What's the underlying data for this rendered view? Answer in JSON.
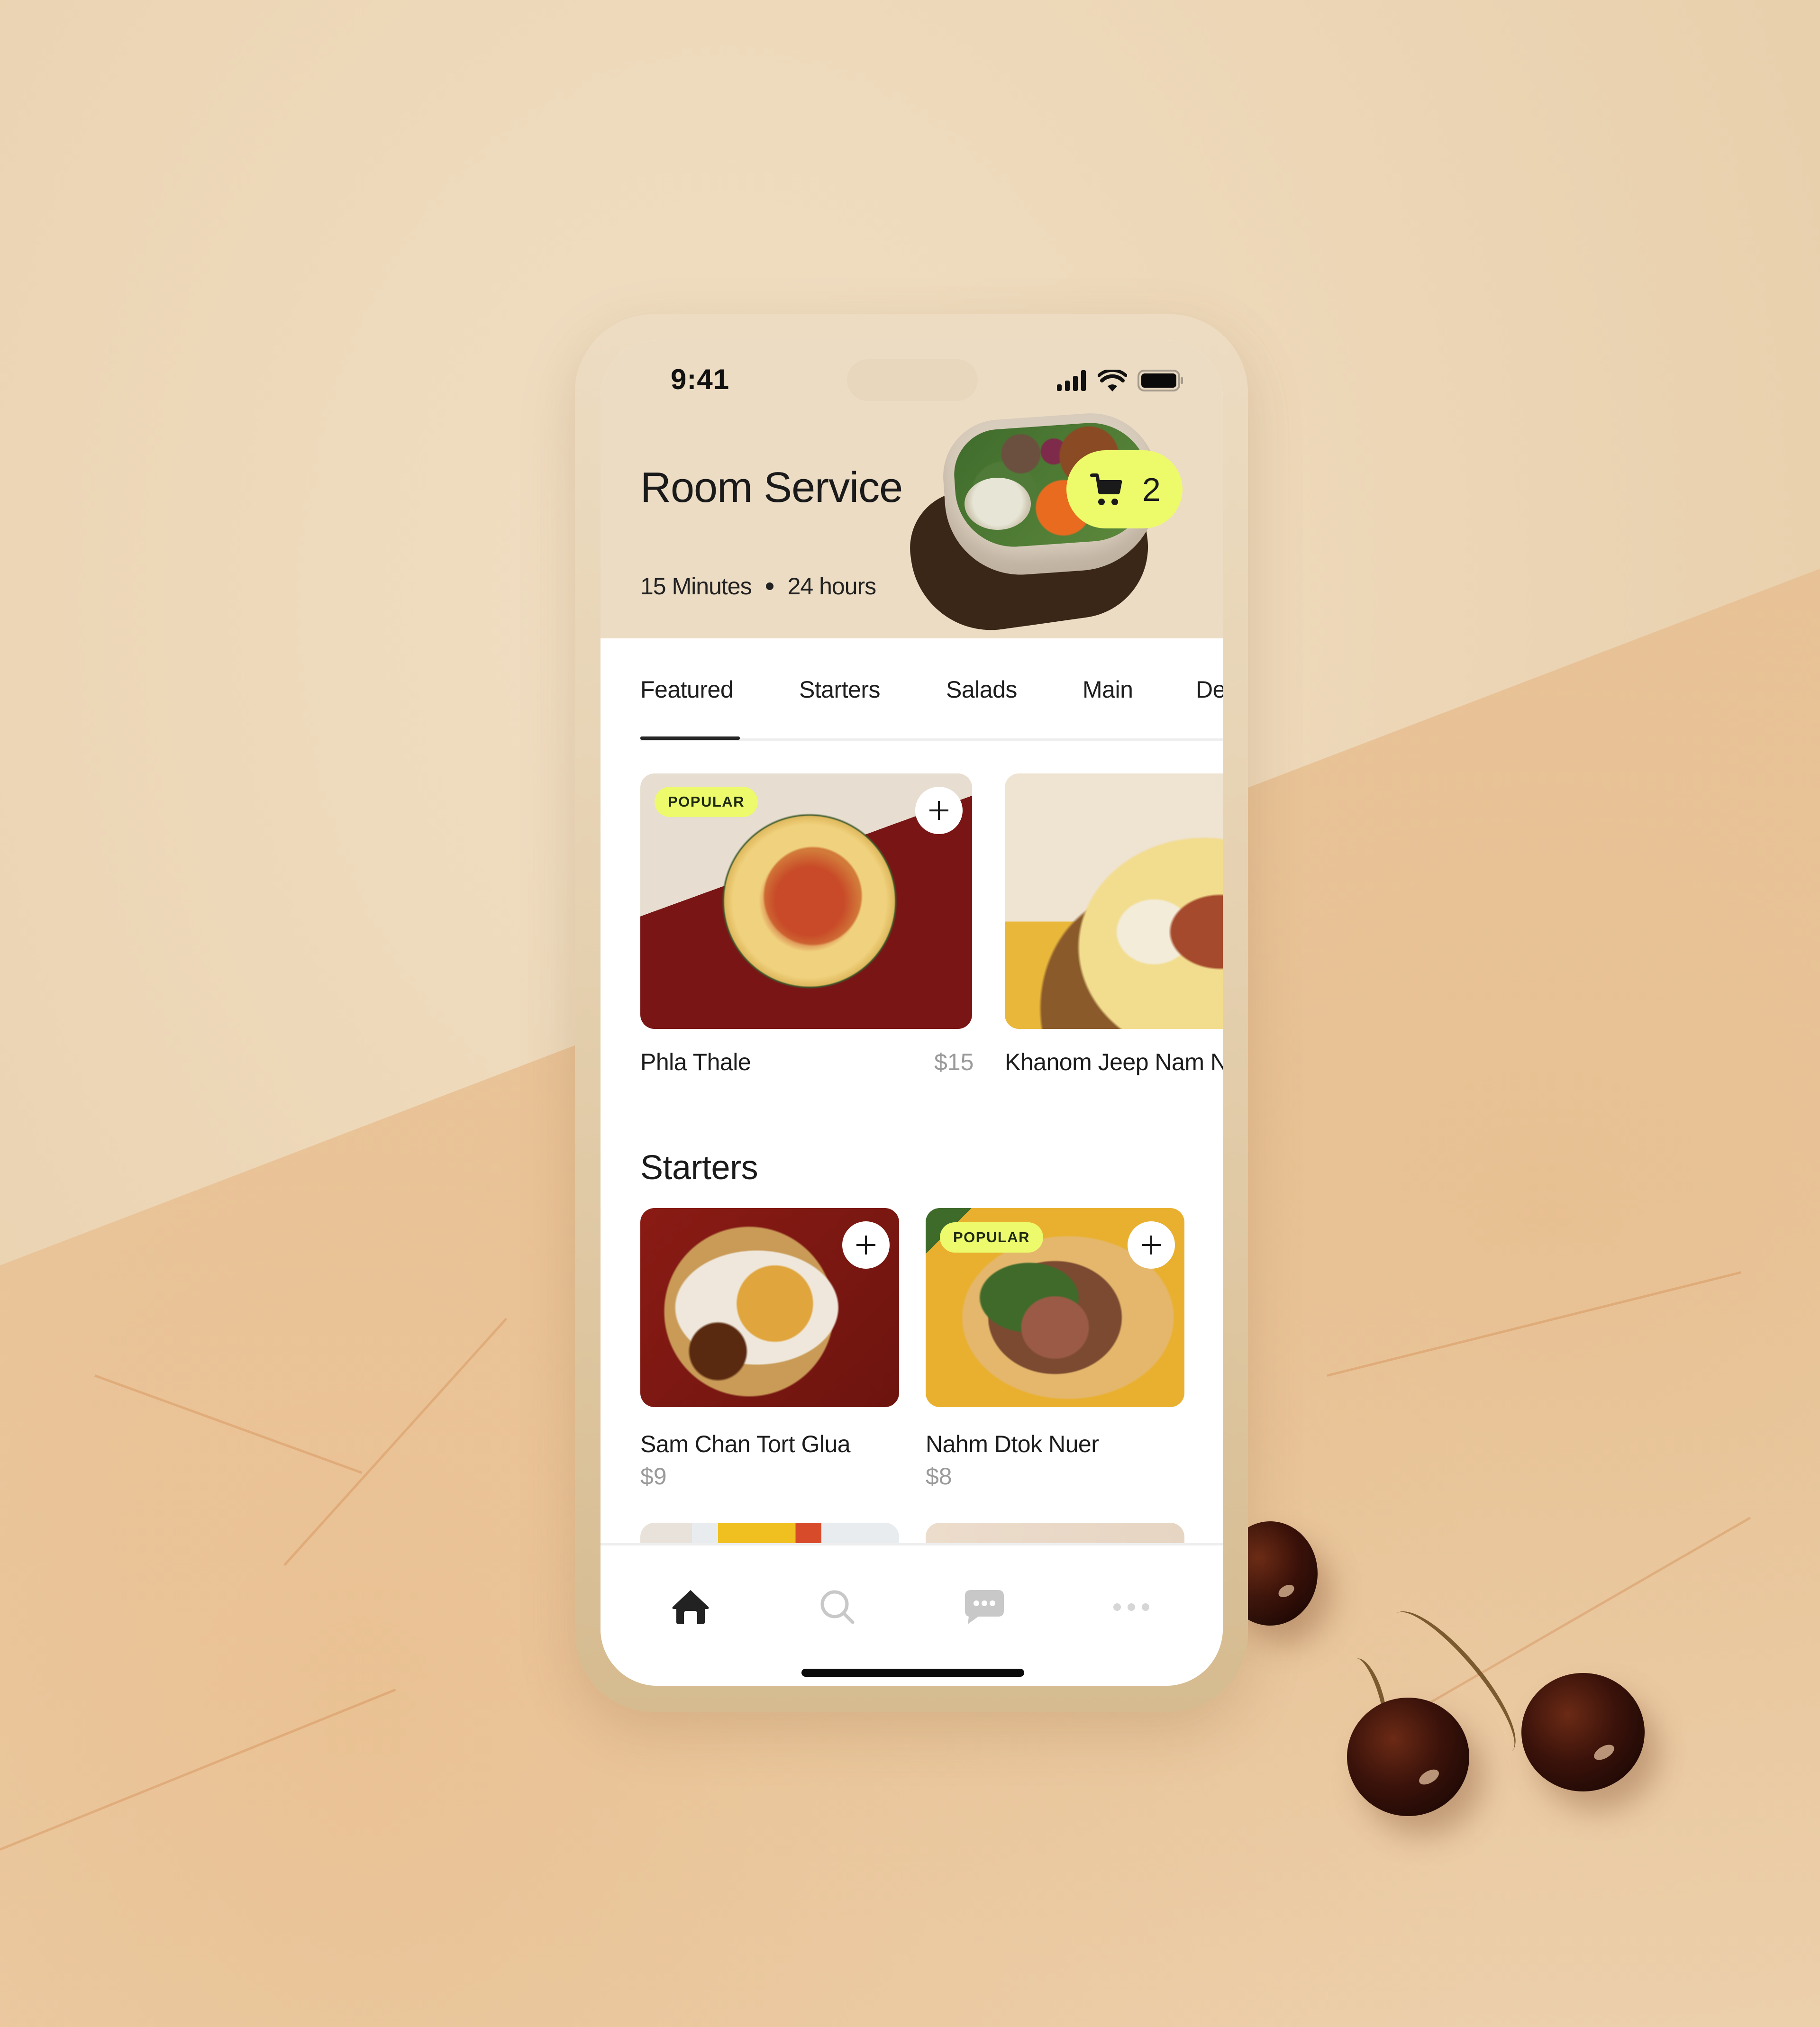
{
  "status_bar": {
    "time": "9:41",
    "icons": [
      "cellular-signal-icon",
      "wifi-icon",
      "battery-icon"
    ]
  },
  "header": {
    "title": "Room Service",
    "delivery_time": "15 Minutes",
    "hours": "24 hours",
    "cart": {
      "icon": "shopping-cart-icon",
      "count": "2",
      "color": "#EDFB6B"
    }
  },
  "tabs": {
    "active": "Featured",
    "items": [
      {
        "label": "Featured"
      },
      {
        "label": "Starters"
      },
      {
        "label": "Salads"
      },
      {
        "label": "Main"
      },
      {
        "label": "De"
      }
    ]
  },
  "featured": {
    "items": [
      {
        "name": "Phla Thale",
        "price": "$15",
        "badge": "POPULAR"
      },
      {
        "name": "Khanom Jeep Nam N",
        "price": ""
      }
    ]
  },
  "starters": {
    "title": "Starters",
    "items": [
      {
        "name": "Sam Chan Tort Glua",
        "price": "$9"
      },
      {
        "name": "Nahm Dtok Nuer",
        "price": "$8",
        "badge": "POPULAR"
      }
    ]
  },
  "bottom_nav": {
    "items": [
      {
        "icon": "home-icon",
        "active": true
      },
      {
        "icon": "search-icon",
        "active": false
      },
      {
        "icon": "chat-icon",
        "active": false
      },
      {
        "icon": "more-icon",
        "active": false
      }
    ]
  },
  "colors": {
    "accent": "#EDFB6B",
    "header_bg": "#ECDCC4",
    "text_primary": "#1A1A1A",
    "text_muted": "#9A9A9A",
    "nav_inactive": "#C8C8C8"
  }
}
